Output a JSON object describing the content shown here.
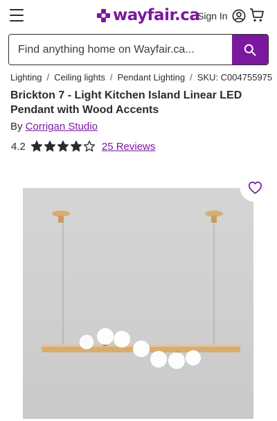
{
  "header": {
    "menu_icon": "hamburger-menu-icon",
    "logo_text": "wayfair.ca",
    "logo_icon": "wayfair-pinwheel-icon",
    "signin_label": "Sign In",
    "account_icon": "account-circle-icon",
    "cart_icon": "shopping-cart-icon"
  },
  "search": {
    "placeholder": "Find anything home on Wayfair.ca...",
    "icon": "search-icon"
  },
  "breadcrumb": {
    "items": [
      "Lighting",
      "Ceiling lights",
      "Pendant Lighting"
    ],
    "separator": "/",
    "sku": "SKU: C004755975"
  },
  "product": {
    "title": "Brickton 7 - Light Kitchen Island Linear LED Pendant with Wood Accents",
    "by_label": "By",
    "brand": "Corrigan Studio",
    "rating": "4.2",
    "rating_value": 4.2,
    "rating_max": 5,
    "reviews_label": "25 Reviews",
    "image_icon": "linear-pendant-light-photo",
    "favorite_icon": "heart-outline-icon"
  },
  "colors": {
    "brand_purple": "#7b189f",
    "text": "#2b2b2b",
    "wood": "#d8ad72"
  }
}
